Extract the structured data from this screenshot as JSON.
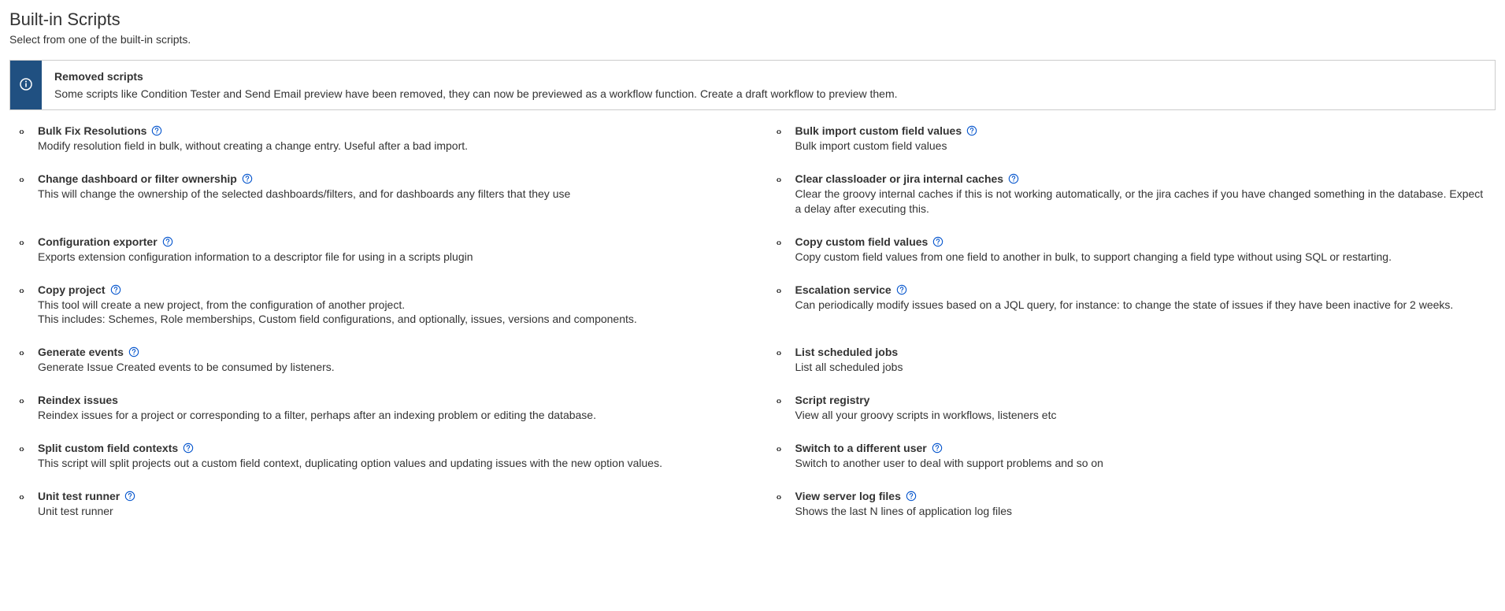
{
  "header": {
    "title": "Built-in Scripts",
    "subtitle": "Select from one of the built-in scripts."
  },
  "info": {
    "title": "Removed scripts",
    "text": "Some scripts like Condition Tester and Send Email preview have been removed, they can now be previewed as a workflow function. Create a draft workflow to preview them."
  },
  "scripts": [
    {
      "title": "Bulk Fix Resolutions",
      "help": true,
      "desc": "Modify resolution field in bulk, without creating a change entry. Useful after a bad import."
    },
    {
      "title": "Bulk import custom field values",
      "help": true,
      "desc": "Bulk import custom field values"
    },
    {
      "title": "Change dashboard or filter ownership",
      "help": true,
      "desc": "This will change the ownership of the selected dashboards/filters, and for dashboards any filters that they use"
    },
    {
      "title": "Clear classloader or jira internal caches",
      "help": true,
      "desc": "Clear the groovy internal caches if this is not working automatically, or the jira caches if you have changed something in the database. Expect a delay after executing this."
    },
    {
      "title": "Configuration exporter",
      "help": true,
      "desc": "Exports extension configuration information to a descriptor file for using in a scripts plugin"
    },
    {
      "title": "Copy custom field values",
      "help": true,
      "desc": "Copy custom field values from one field to another in bulk, to support changing a field type without using SQL or restarting."
    },
    {
      "title": "Copy project",
      "help": true,
      "desc": "This tool will create a new project, from the configuration of another project.\nThis includes: Schemes, Role memberships, Custom field configurations, and optionally, issues, versions and components."
    },
    {
      "title": "Escalation service",
      "help": true,
      "desc": "Can periodically modify issues based on a JQL query, for instance: to change the state of issues if they have been inactive for 2 weeks."
    },
    {
      "title": "Generate events",
      "help": true,
      "desc": "Generate Issue Created events to be consumed by listeners."
    },
    {
      "title": "List scheduled jobs",
      "help": false,
      "desc": "List all scheduled jobs"
    },
    {
      "title": "Reindex issues",
      "help": false,
      "desc": "Reindex issues for a project or corresponding to a filter, perhaps after an indexing problem or editing the database."
    },
    {
      "title": "Script registry",
      "help": false,
      "desc": "View all your groovy scripts in workflows, listeners etc"
    },
    {
      "title": "Split custom field contexts",
      "help": true,
      "desc": "This script will split projects out a custom field context, duplicating option values and updating issues with the new option values."
    },
    {
      "title": "Switch to a different user",
      "help": true,
      "desc": "Switch to another user to deal with support problems and so on"
    },
    {
      "title": "Unit test runner",
      "help": true,
      "desc": "Unit test runner"
    },
    {
      "title": "View server log files",
      "help": true,
      "desc": "Shows the last N lines of application log files"
    }
  ]
}
